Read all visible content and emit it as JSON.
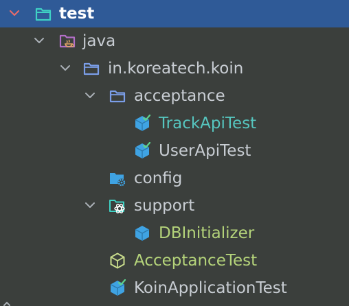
{
  "tree": {
    "root": {
      "label": "test",
      "icon": "test-folder-icon",
      "expanded": true,
      "selected": true
    },
    "java": {
      "label": "java",
      "icon": "java-source-folder-icon",
      "expanded": true
    },
    "package": {
      "label": "in.koreatech.koin",
      "icon": "package-folder-icon",
      "expanded": true
    },
    "acceptance": {
      "label": "acceptance",
      "icon": "package-folder-icon",
      "expanded": true,
      "children": [
        {
          "label": "TrackApiTest",
          "icon": "test-class-icon",
          "color": "#56c6bf"
        },
        {
          "label": "UserApiTest",
          "icon": "test-class-icon"
        }
      ]
    },
    "config": {
      "label": "config",
      "icon": "config-folder-icon"
    },
    "support": {
      "label": "support",
      "icon": "support-folder-icon",
      "expanded": true,
      "children": [
        {
          "label": "DBInitializer",
          "icon": "class-icon",
          "color": "#b4d37a"
        }
      ]
    },
    "acceptance_test": {
      "label": "AcceptanceTest",
      "icon": "abstract-class-icon",
      "color": "#b4d37a"
    },
    "app_test": {
      "label": "KoinApplicationTest",
      "icon": "test-class-icon"
    }
  },
  "colors": {
    "background": "#3b3f3c",
    "selection": "#2f5a97",
    "teal": "#56c6bf",
    "green": "#b4d37a",
    "folder_blue": "#7b9ee8",
    "class_blue": "#3fa3e3"
  }
}
